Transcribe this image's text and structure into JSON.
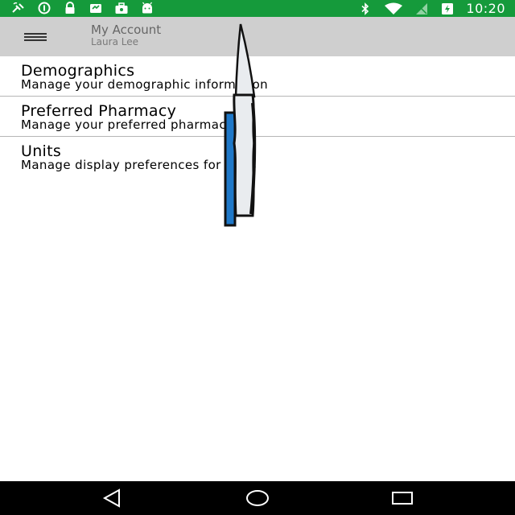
{
  "status_bar": {
    "clock": "10:20",
    "background": "#159a3b",
    "left_icons": [
      "satellite-icon",
      "circle-info-icon",
      "lock-icon",
      "cloud-message-icon",
      "briefcase-icon",
      "android-icon"
    ],
    "right_icons": [
      "bluetooth-icon",
      "wifi-icon",
      "no-signal-icon",
      "battery-charging-icon"
    ]
  },
  "app_bar": {
    "title": "My Account",
    "subtitle": "Laura Lee",
    "background": "#cfcfcf",
    "menu_icon": "hamburger-menu-icon"
  },
  "list": {
    "items": [
      {
        "title": "Demographics",
        "subtitle": "Manage your demographic information"
      },
      {
        "title": "Preferred Pharmacy",
        "subtitle": "Manage your preferred pharmacy"
      },
      {
        "title": "Units",
        "subtitle": "Manage display preferences for units"
      }
    ]
  },
  "nav_bar": {
    "background": "#000000",
    "buttons": [
      "back-triangle-icon",
      "home-circle-icon",
      "recents-square-icon"
    ]
  }
}
